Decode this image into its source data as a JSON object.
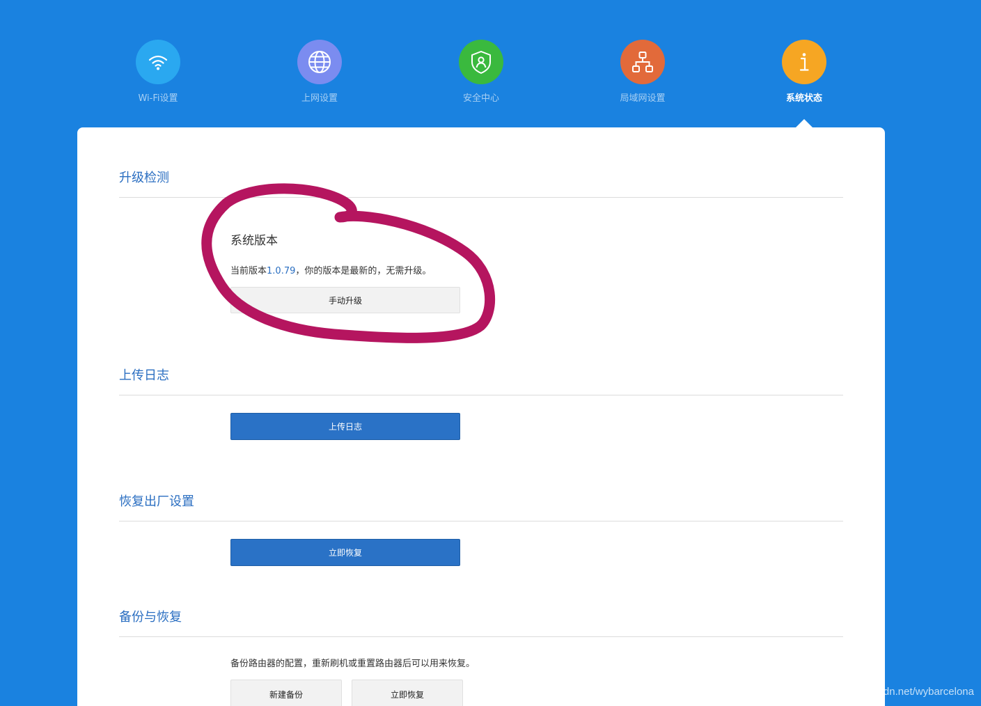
{
  "nav": {
    "items": [
      {
        "label": "Wi-Fi设置",
        "icon": "wifi-icon",
        "color": "#2aa8f0"
      },
      {
        "label": "上网设置",
        "icon": "globe-icon",
        "color": "#7b8cf0"
      },
      {
        "label": "安全中心",
        "icon": "shield-user-icon",
        "color": "#3ab93e"
      },
      {
        "label": "局域网设置",
        "icon": "network-icon",
        "color": "#e26a3a"
      },
      {
        "label": "系统状态",
        "icon": "info-icon",
        "color": "#f6a623",
        "active": true
      }
    ]
  },
  "sections": {
    "upgrade": {
      "title": "升级检测",
      "subheading": "系统版本",
      "info_prefix": "当前版本",
      "version": "1.0.79",
      "info_suffix": "，你的版本是最新的，无需升级。",
      "button": "手动升级"
    },
    "upload_log": {
      "title": "上传日志",
      "button": "上传日志"
    },
    "factory_reset": {
      "title": "恢复出厂设置",
      "button": "立即恢复"
    },
    "backup": {
      "title": "备份与恢复",
      "description": "备份路由器的配置，重新刷机或重置路由器后可以用来恢复。",
      "new_backup_button": "新建备份",
      "restore_button": "立即恢复"
    }
  },
  "colors": {
    "background": "#1a82e0",
    "accent": "#2a6ec1",
    "annotation": "#b5155f"
  },
  "watermark": "https://blog.csdn.net/wybarcelona"
}
